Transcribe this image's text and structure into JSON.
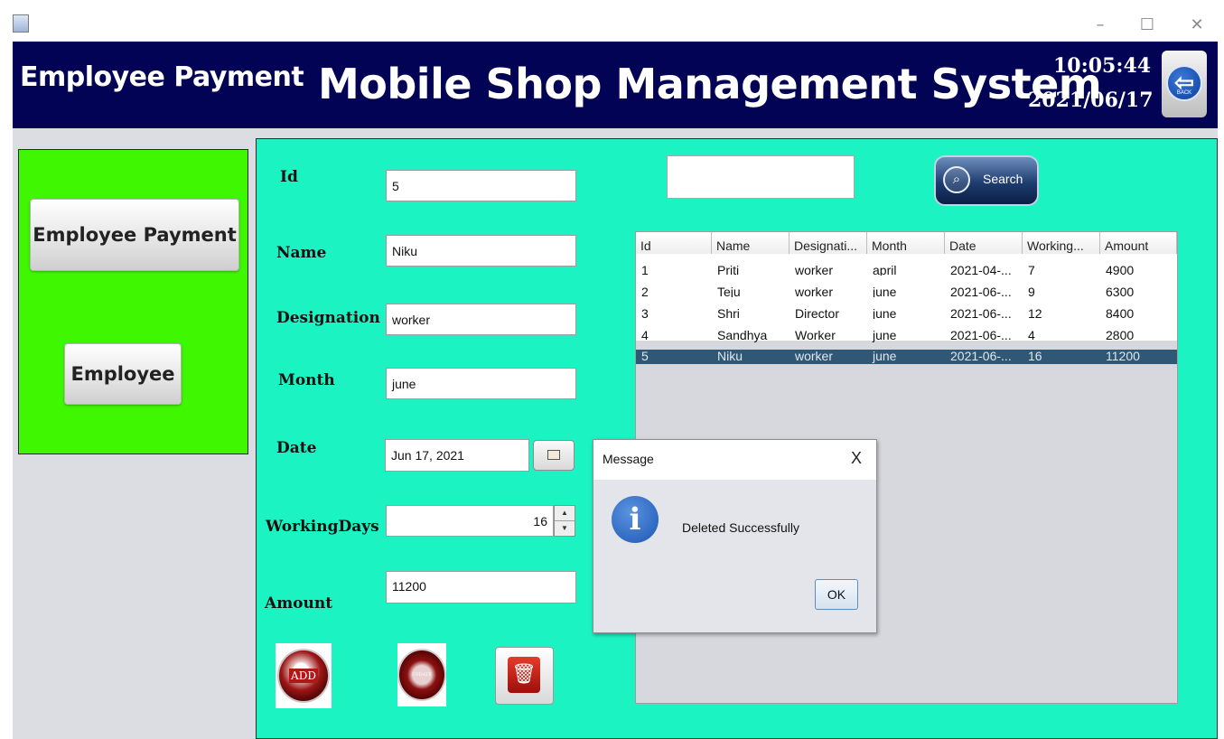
{
  "window": {
    "minimize": "–",
    "maximize": "☐",
    "close": "✕"
  },
  "header": {
    "page_title": "Employee Payment",
    "app_title": "Mobile Shop Management System",
    "time": "10:05:44",
    "date": "2021/06/17",
    "back_label": "BACK",
    "back_icon": "arrow-left-icon"
  },
  "sidebar": {
    "employee_payment_label": "Employee Payment",
    "employee_label": "Employee"
  },
  "form": {
    "id_label": "Id",
    "id_value": "5",
    "name_label": "Name",
    "name_value": "Niku",
    "designation_label": "Designation",
    "designation_value": "worker",
    "month_label": "Month",
    "month_value": "june",
    "date_label": "Date",
    "date_value": "Jun 17, 2021",
    "working_days_label": "WorkingDays",
    "working_days_value": "16",
    "amount_label": "Amount",
    "amount_value": "11200",
    "add_label": "ADD",
    "update_label": "UPDATE"
  },
  "search": {
    "value": "",
    "button_label": "Search"
  },
  "table": {
    "columns": [
      "Id",
      "Name",
      "Designati...",
      "Month",
      "Date",
      "Working...",
      "Amount"
    ],
    "rows": [
      [
        "1",
        "Priti",
        "worker",
        "april",
        "2021-04-...",
        "7",
        "4900"
      ],
      [
        "2",
        "Teju",
        "worker",
        "june",
        "2021-06-...",
        "9",
        "6300"
      ],
      [
        "3",
        "Shri",
        "Director",
        "june",
        "2021-06-...",
        "12",
        "8400"
      ],
      [
        "4",
        "Sandhya",
        "Worker",
        "june",
        "2021-06-...",
        "4",
        "2800"
      ],
      [
        "5",
        "Niku",
        "worker",
        "june",
        "2021-06-...",
        "16",
        "11200"
      ]
    ],
    "selected_row": 4
  },
  "dialog": {
    "title": "Message",
    "close": "X",
    "message": "Deleted Successfully",
    "icon_glyph": "i",
    "ok_label": "OK"
  },
  "colors": {
    "header_bg": "#030355",
    "sidebar_bg": "#3ff700",
    "main_bg": "#1cf3c3",
    "selected_row": "#2e5876"
  }
}
